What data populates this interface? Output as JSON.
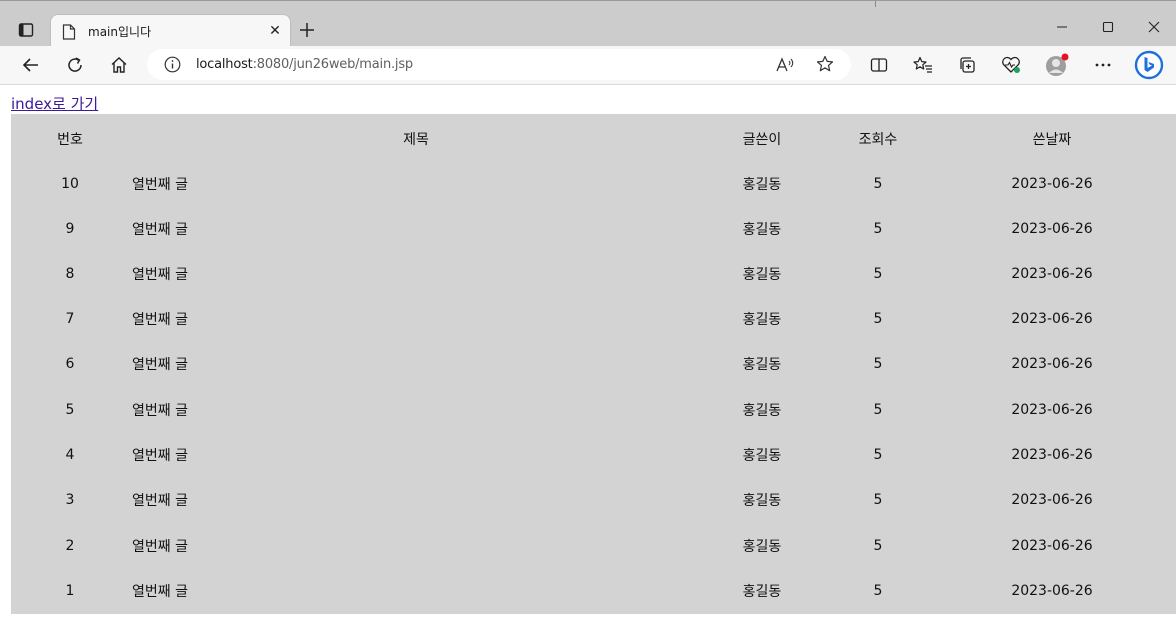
{
  "browser": {
    "tab": {
      "title": "main입니다",
      "close_glyph": "✕"
    },
    "new_tab_glyph": "+",
    "url": {
      "host": "localhost",
      "path": ":8080/jun26web/main.jsp"
    },
    "icons": [
      "tab-actions-icon",
      "page-icon",
      "close-icon",
      "plus-icon",
      "minimize-icon",
      "maximize-icon",
      "close-window-icon",
      "back-icon",
      "refresh-icon",
      "home-icon",
      "info-icon",
      "read-aloud-icon",
      "favorite-star-icon",
      "split-screen-icon",
      "favorites-icon",
      "collections-icon",
      "browser-essentials-icon",
      "profile-avatar-icon",
      "more-icon",
      "bing-icon"
    ]
  },
  "page": {
    "link_label": "index로 가기",
    "table": {
      "headers": {
        "no": "번호",
        "title": "제목",
        "writer": "글쓴이",
        "hits": "조회수",
        "date": "쓴날짜"
      },
      "rows": [
        {
          "no": "10",
          "title": "열번째 글",
          "writer": "홍길동",
          "hits": "5",
          "date": "2023-06-26"
        },
        {
          "no": "9",
          "title": "열번째 글",
          "writer": "홍길동",
          "hits": "5",
          "date": "2023-06-26"
        },
        {
          "no": "8",
          "title": "열번째 글",
          "writer": "홍길동",
          "hits": "5",
          "date": "2023-06-26"
        },
        {
          "no": "7",
          "title": "열번째 글",
          "writer": "홍길동",
          "hits": "5",
          "date": "2023-06-26"
        },
        {
          "no": "6",
          "title": "열번째 글",
          "writer": "홍길동",
          "hits": "5",
          "date": "2023-06-26"
        },
        {
          "no": "5",
          "title": "열번째 글",
          "writer": "홍길동",
          "hits": "5",
          "date": "2023-06-26"
        },
        {
          "no": "4",
          "title": "열번째 글",
          "writer": "홍길동",
          "hits": "5",
          "date": "2023-06-26"
        },
        {
          "no": "3",
          "title": "열번째 글",
          "writer": "홍길동",
          "hits": "5",
          "date": "2023-06-26"
        },
        {
          "no": "2",
          "title": "열번째 글",
          "writer": "홍길동",
          "hits": "5",
          "date": "2023-06-26"
        },
        {
          "no": "1",
          "title": "열번째 글",
          "writer": "홍길동",
          "hits": "5",
          "date": "2023-06-26"
        }
      ]
    }
  },
  "colors": {
    "tabstrip": "#cccccc",
    "toolbar": "#f7f7f7",
    "table_bg": "#d3d3d3",
    "link": "#3b1a9a",
    "profile_dot": "#e81123"
  }
}
